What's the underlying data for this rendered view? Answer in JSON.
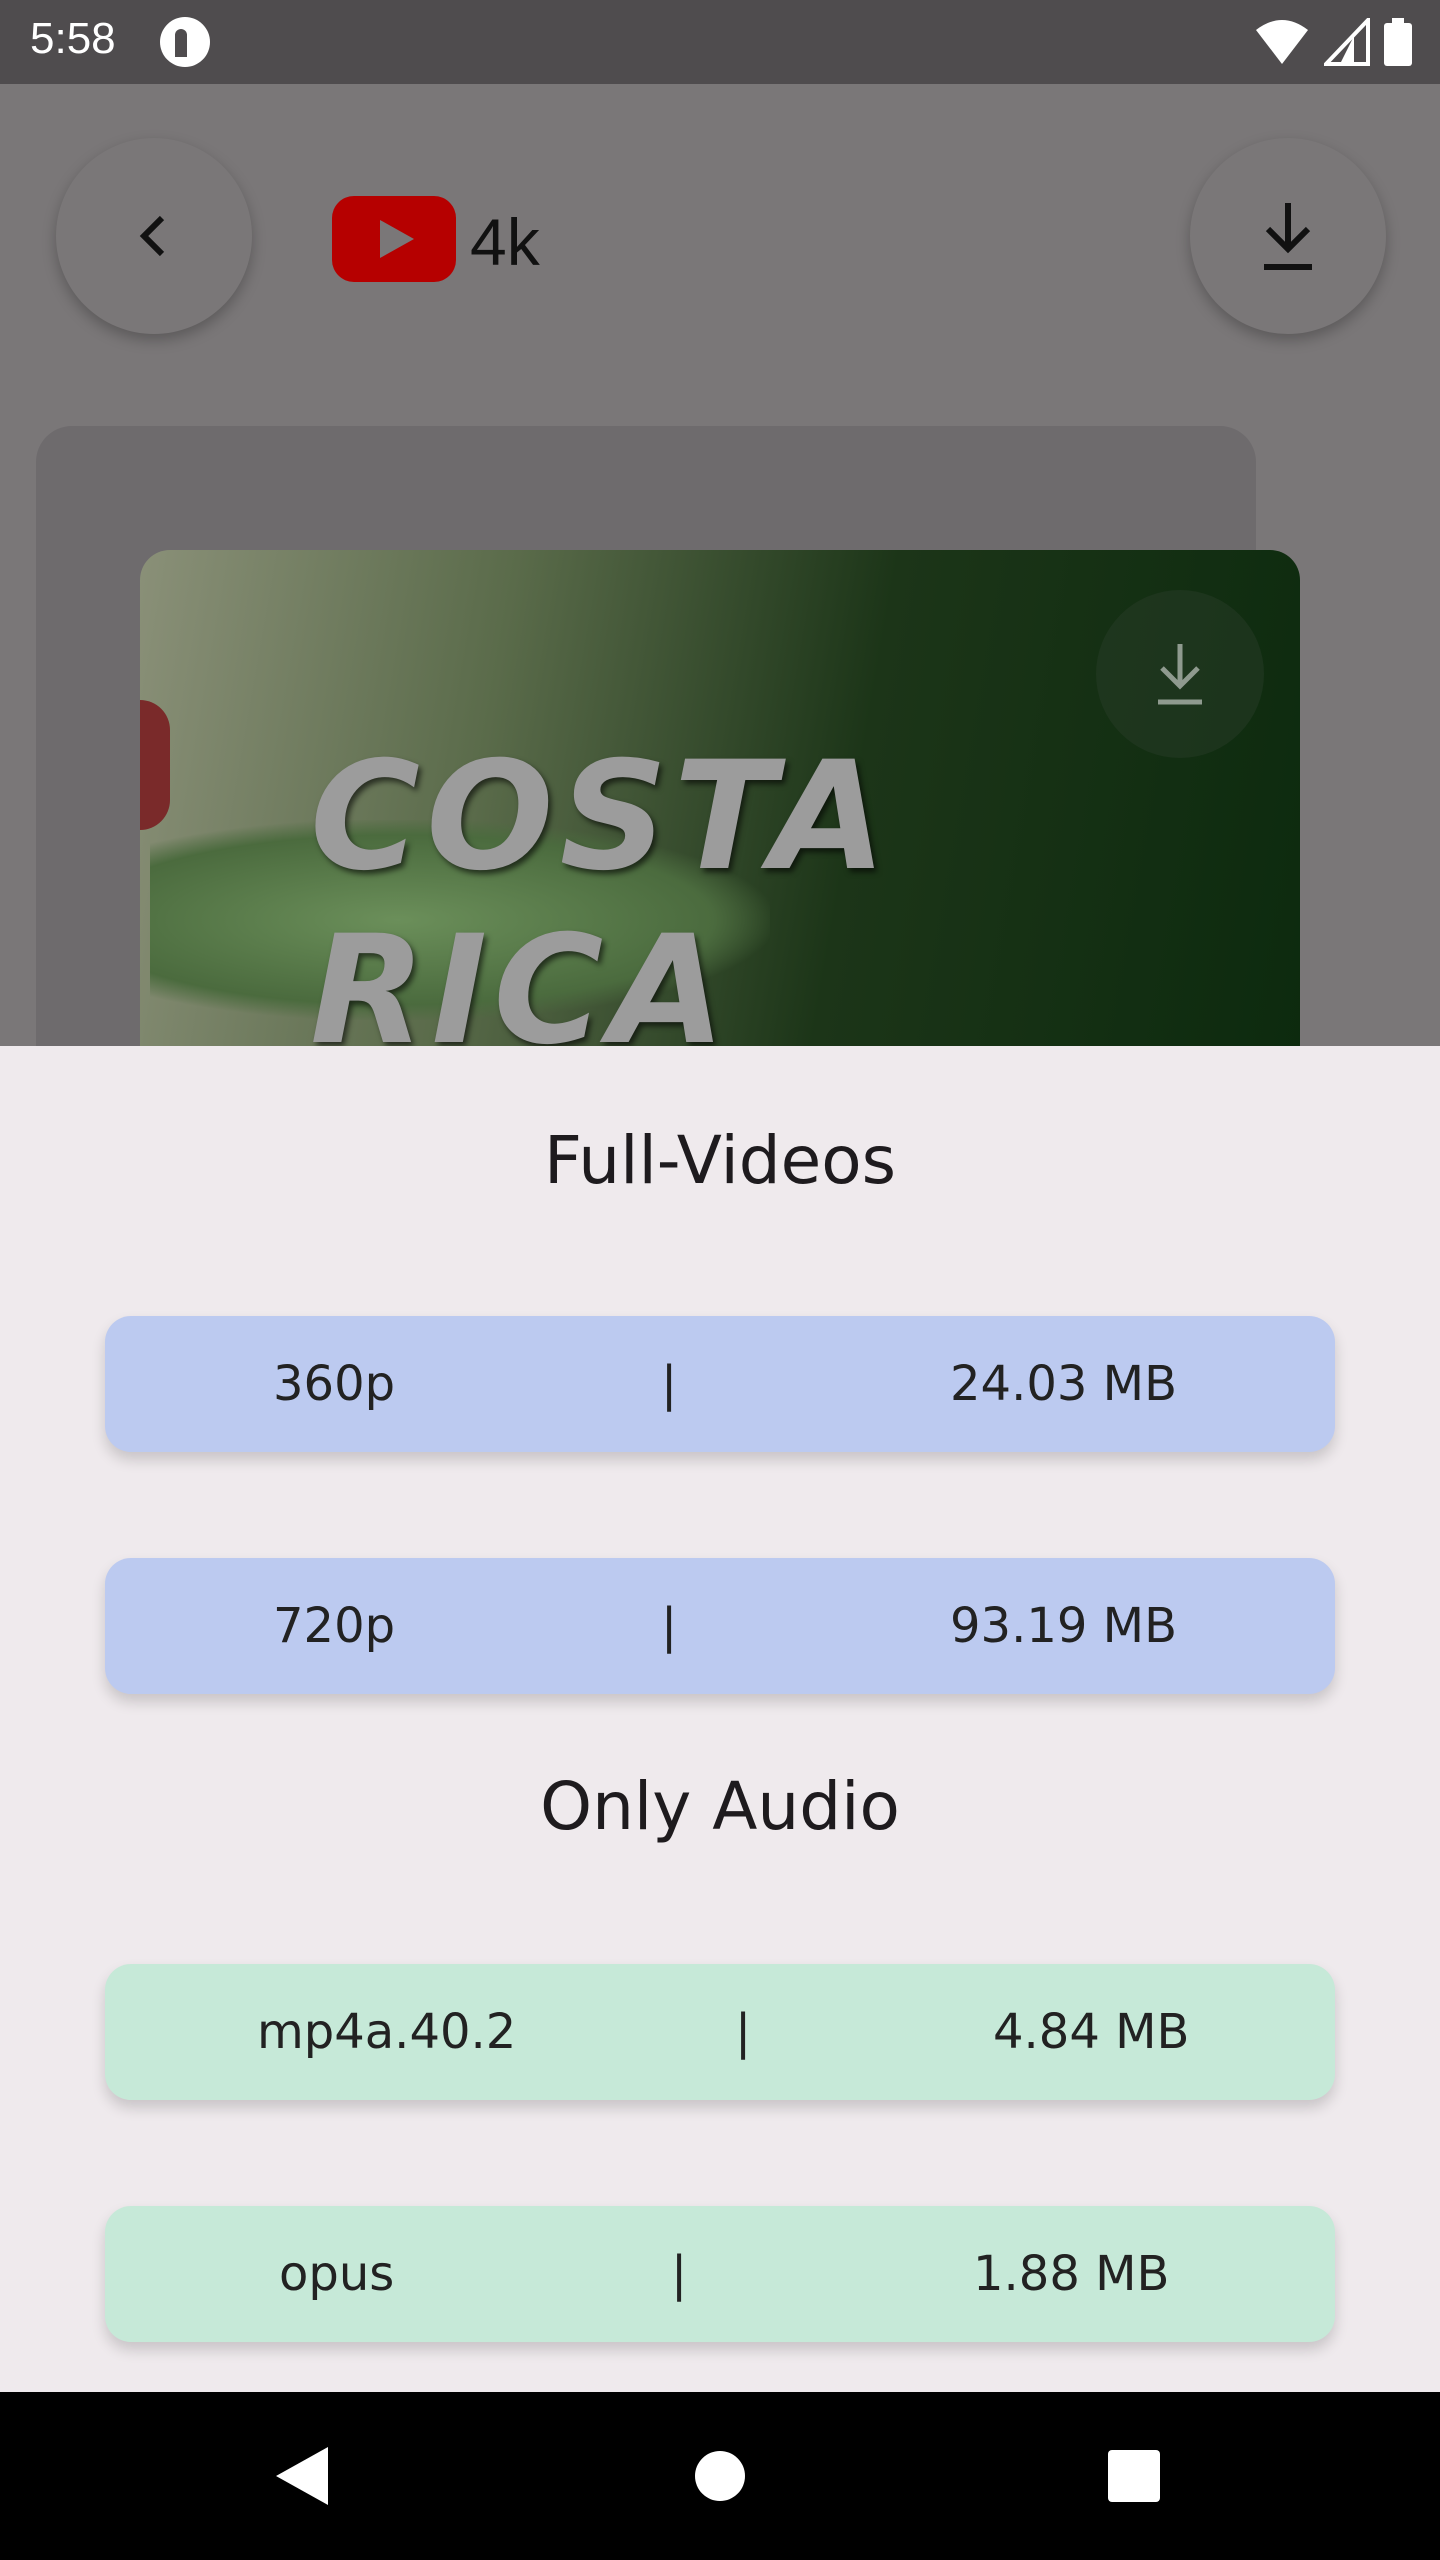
{
  "status_bar": {
    "time": "5:58"
  },
  "header": {
    "title": "4k"
  },
  "thumbnail": {
    "overlay_text": "COSTA RICA"
  },
  "sheet": {
    "video_section_title": "Full-Videos",
    "video_options": [
      {
        "quality": "360p",
        "separator": "|",
        "size": "24.03 MB"
      },
      {
        "quality": "720p",
        "separator": "|",
        "size": "93.19 MB"
      }
    ],
    "audio_section_title": "Only Audio",
    "audio_options": [
      {
        "codec": "mp4a.40.2",
        "separator": "|",
        "size": "4.84 MB"
      },
      {
        "codec": "opus",
        "separator": "|",
        "size": "1.88 MB"
      }
    ]
  },
  "colors": {
    "video_option_bg": "#bccaf0",
    "audio_option_bg": "#c6e9d8",
    "sheet_bg": "#efeaed",
    "youtube_red": "#b60000"
  },
  "icons": [
    "app-badge-icon",
    "wifi-icon",
    "signal-icon",
    "battery-icon",
    "back-icon",
    "youtube-logo",
    "download-icon",
    "nav-back-icon",
    "nav-home-icon",
    "nav-recents-icon"
  ]
}
